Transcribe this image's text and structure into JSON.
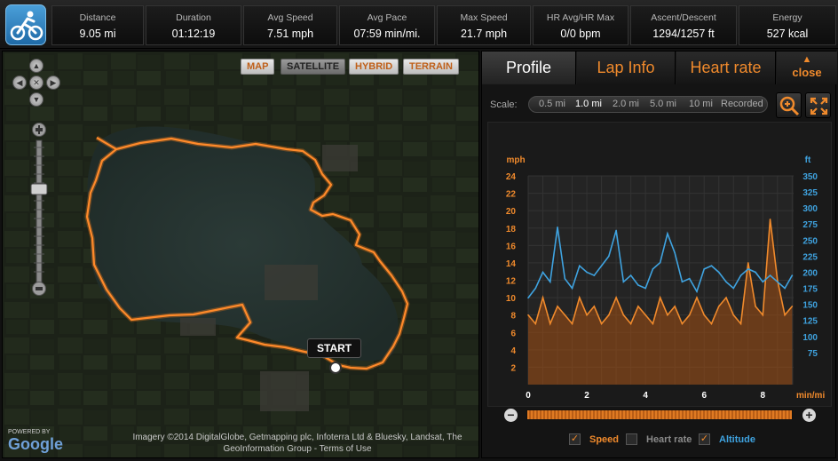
{
  "stats": [
    {
      "label": "Distance",
      "value": "9.05 mi"
    },
    {
      "label": "Duration",
      "value": "01:12:19"
    },
    {
      "label": "Avg Speed",
      "value": "7.51 mph"
    },
    {
      "label": "Avg Pace",
      "value": "07:59 min/mi."
    },
    {
      "label": "Max Speed",
      "value": "21.7 mph"
    },
    {
      "label": "HR Avg/HR Max",
      "value": "0/0 bpm"
    },
    {
      "label": "Ascent/Descent",
      "value": "1294/1257 ft"
    },
    {
      "label": "Energy",
      "value": "527 kcal"
    }
  ],
  "sport_icon": "cycling-icon",
  "map": {
    "types": [
      "MAP",
      "SATELLITE",
      "HYBRID",
      "TERRAIN"
    ],
    "active_type": "SATELLITE",
    "start_label": "START",
    "powered_by": "POWERED BY",
    "google_logo": "Google",
    "attribution": "Imagery ©2014  DigitalGlobe, Getmapping plc, Infoterra Ltd & Bluesky, Landsat, The GeoInformation Group - Terms of Use",
    "route_color": "#f07a1e"
  },
  "panel": {
    "tabs": [
      "Profile",
      "Lap Info",
      "Heart rate"
    ],
    "active_tab": "Profile",
    "close_label": "close",
    "scale_label": "Scale:",
    "scale_options": [
      "0.5 mi",
      "1.0 mi",
      "2.0 mi",
      "5.0 mi",
      "10 mi",
      "Recorded"
    ],
    "scale_selected": "1.0 mi",
    "legend": [
      {
        "label": "Speed",
        "checked": true,
        "color": "#f08a2c"
      },
      {
        "label": "Heart rate",
        "checked": false,
        "color": "#8a8a8a"
      },
      {
        "label": "Altitude",
        "checked": true,
        "color": "#3fa3e0"
      }
    ]
  },
  "chart_data": {
    "type": "line",
    "left_axis": {
      "unit": "mph",
      "ticks": [
        2,
        4,
        6,
        8,
        10,
        12,
        14,
        16,
        18,
        20,
        22,
        24
      ],
      "range": [
        0,
        24
      ]
    },
    "right_axis": {
      "unit": "ft",
      "ticks": [
        75,
        100,
        125,
        150,
        175,
        200,
        225,
        250,
        275,
        300,
        325,
        350
      ],
      "range": [
        25,
        350
      ]
    },
    "x_axis": {
      "unit": "min/mi",
      "ticks": [
        0,
        2,
        4,
        6,
        8
      ],
      "range": [
        0,
        9.05
      ]
    },
    "series": [
      {
        "name": "Speed",
        "color": "#f08a2c",
        "axis": "left",
        "x": [
          0,
          0.25,
          0.5,
          0.75,
          1.0,
          1.25,
          1.5,
          1.75,
          2.0,
          2.25,
          2.5,
          2.75,
          3.0,
          3.25,
          3.5,
          3.75,
          4.0,
          4.25,
          4.5,
          4.75,
          5.0,
          5.25,
          5.5,
          5.75,
          6.0,
          6.25,
          6.5,
          6.75,
          7.0,
          7.25,
          7.5,
          7.75,
          8.0,
          8.25,
          8.5,
          8.75,
          9.0
        ],
        "values": [
          8,
          7,
          10,
          7,
          9,
          8,
          7,
          10,
          8,
          9,
          7,
          8,
          10,
          8,
          7,
          9,
          8,
          7,
          10,
          8,
          9,
          7,
          8,
          10,
          8,
          7,
          9,
          10,
          8,
          7,
          14,
          9,
          8,
          19,
          12,
          8,
          9
        ]
      },
      {
        "name": "Altitude",
        "color": "#3fa3e0",
        "axis": "right",
        "x": [
          0,
          0.25,
          0.5,
          0.75,
          1.0,
          1.25,
          1.5,
          1.75,
          2.0,
          2.25,
          2.5,
          2.75,
          3.0,
          3.25,
          3.5,
          3.75,
          4.0,
          4.25,
          4.5,
          4.75,
          5.0,
          5.25,
          5.5,
          5.75,
          6.0,
          6.25,
          6.5,
          6.75,
          7.0,
          7.25,
          7.5,
          7.75,
          8.0,
          8.25,
          8.5,
          8.75,
          9.0
        ],
        "values": [
          160,
          175,
          200,
          185,
          270,
          190,
          175,
          210,
          200,
          195,
          210,
          225,
          265,
          185,
          195,
          180,
          175,
          205,
          215,
          260,
          230,
          185,
          190,
          170,
          205,
          210,
          200,
          185,
          175,
          195,
          205,
          200,
          185,
          195,
          185,
          175,
          195
        ]
      }
    ]
  }
}
